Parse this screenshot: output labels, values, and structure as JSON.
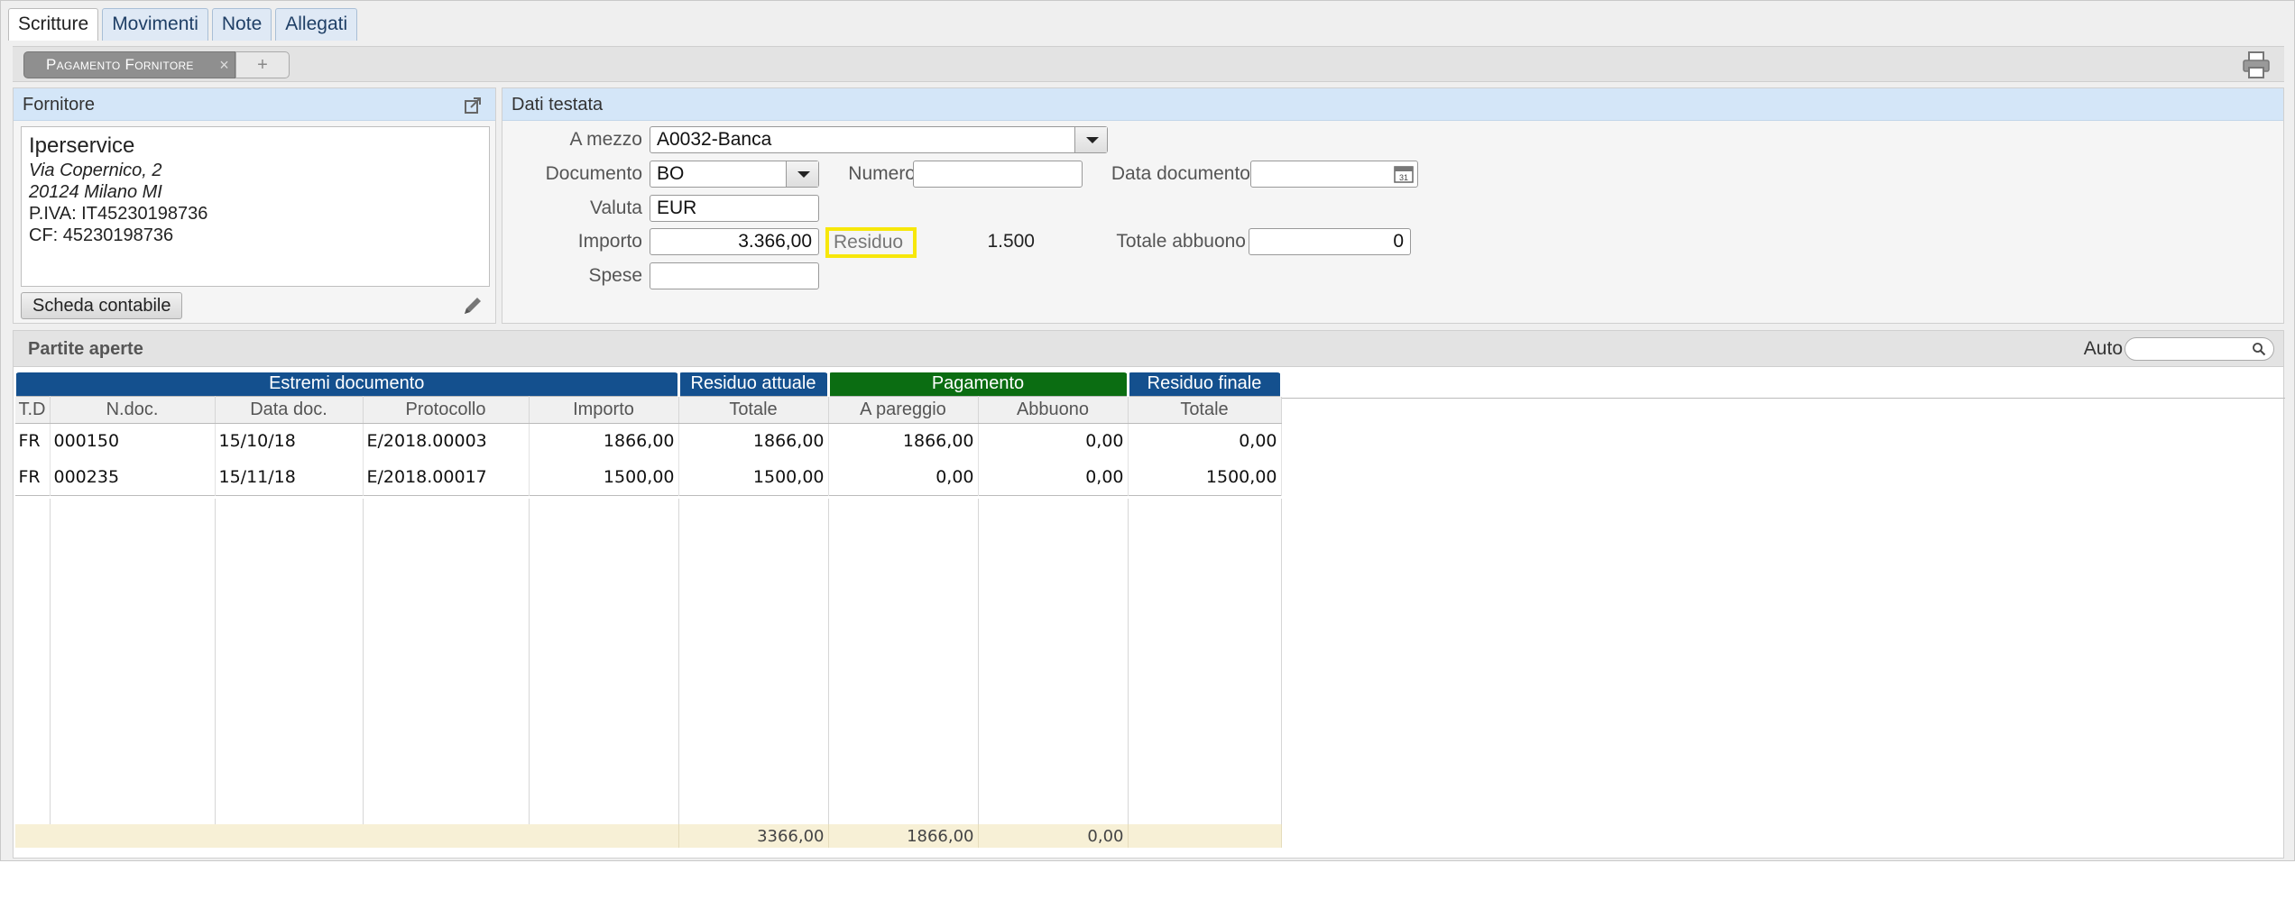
{
  "tabs": [
    "Scritture",
    "Movimenti",
    "Note",
    "Allegati"
  ],
  "doc_tab": {
    "label": "Pagamento Fornitore",
    "close": "×",
    "add": "+"
  },
  "supplier": {
    "title": "Fornitore",
    "name": "Iperservice",
    "address1": "Via Copernico, 2",
    "address2": "20124 Milano  MI",
    "piva": "P.IVA: IT45230198736",
    "cf": "CF: 45230198736",
    "scheda_button": "Scheda contabile"
  },
  "header": {
    "title": "Dati testata",
    "a_mezzo_label": "A mezzo",
    "a_mezzo_value": "A0032-Banca",
    "documento_label": "Documento",
    "documento_value": "BO",
    "numero_label": "Numero",
    "numero_value": "",
    "data_documento_label": "Data documento",
    "data_documento_value": "",
    "valuta_label": "Valuta",
    "valuta_value": "EUR",
    "importo_label": "Importo",
    "importo_value": "3.366,00",
    "residuo_label": "Residuo",
    "residuo_value": "1.500",
    "totale_abbuono_label": "Totale abbuono",
    "totale_abbuono_value": "0",
    "spese_label": "Spese",
    "spese_value": ""
  },
  "open_items": {
    "title": "Partite aperte",
    "auto_label": "Auto",
    "group_headers": {
      "estremi": "Estremi documento",
      "residuo_attuale": "Residuo attuale",
      "pagamento": "Pagamento",
      "residuo_finale": "Residuo finale"
    },
    "columns": [
      "T.D",
      "N.doc.",
      "Data doc.",
      "Protocollo",
      "Importo",
      "Totale",
      "A pareggio",
      "Abbuono",
      "Totale"
    ],
    "rows": [
      [
        "FR",
        "000150",
        "15/10/18",
        "E/2018.00003",
        "1866,00",
        "1866,00",
        "1866,00",
        "0,00",
        "0,00"
      ],
      [
        "FR",
        "000235",
        "15/11/18",
        "E/2018.00017",
        "1500,00",
        "1500,00",
        "0,00",
        "0,00",
        "1500,00"
      ]
    ],
    "totals": {
      "residuo_attuale": "3366,00",
      "a_pareggio": "1866,00",
      "abbuono": "0,00"
    }
  }
}
